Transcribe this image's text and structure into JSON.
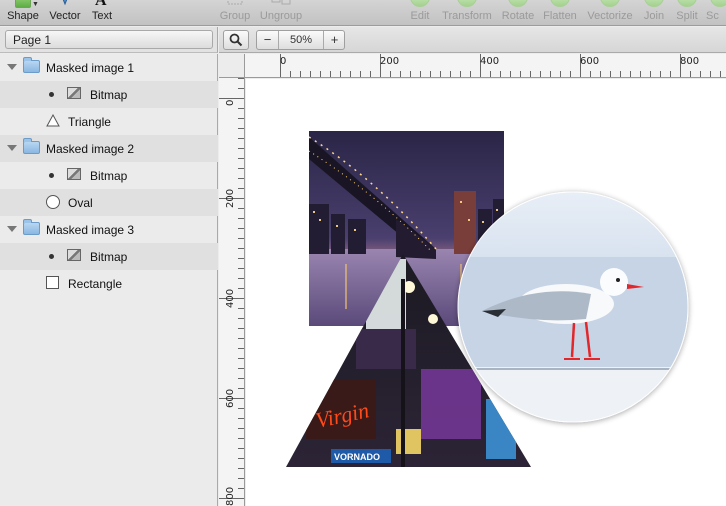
{
  "toolbar": {
    "tools": [
      {
        "label": "Shape",
        "icon": "shape-icon",
        "enabled": true
      },
      {
        "label": "Vector",
        "icon": "vector-pen-icon",
        "enabled": true
      },
      {
        "label": "Text",
        "icon": "text-icon",
        "enabled": true
      },
      {
        "label": "Group",
        "icon": "group-icon",
        "enabled": false
      },
      {
        "label": "Ungroup",
        "icon": "ungroup-icon",
        "enabled": false
      },
      {
        "label": "Edit",
        "icon": "edit-icon",
        "enabled": false
      },
      {
        "label": "Transform",
        "icon": "transform-icon",
        "enabled": false
      },
      {
        "label": "Rotate",
        "icon": "rotate-icon",
        "enabled": false
      },
      {
        "label": "Flatten",
        "icon": "flatten-icon",
        "enabled": false
      },
      {
        "label": "Vectorize",
        "icon": "vectorize-icon",
        "enabled": false
      },
      {
        "label": "Join",
        "icon": "join-icon",
        "enabled": false
      },
      {
        "label": "Split",
        "icon": "split-icon",
        "enabled": false
      },
      {
        "label": "Sc",
        "icon": "scissors-icon",
        "enabled": false
      }
    ]
  },
  "pages": {
    "current": "Page 1"
  },
  "canvas_bar": {
    "zoom": "50%",
    "zoom_out": "−",
    "zoom_in": "+"
  },
  "layers": [
    {
      "label": "Masked image 1",
      "type": "group"
    },
    {
      "label": "Bitmap",
      "type": "bitmap"
    },
    {
      "label": "Triangle",
      "type": "triangle"
    },
    {
      "label": "Masked image 2",
      "type": "group"
    },
    {
      "label": "Bitmap",
      "type": "bitmap"
    },
    {
      "label": "Oval",
      "type": "oval"
    },
    {
      "label": "Masked image 3",
      "type": "group"
    },
    {
      "label": "Bitmap",
      "type": "bitmap"
    },
    {
      "label": "Rectangle",
      "type": "rectangle"
    }
  ],
  "rulers": {
    "horizontal": [
      "0",
      "200",
      "400",
      "600",
      "800"
    ],
    "vertical": [
      "0",
      "200",
      "400",
      "600",
      "800"
    ]
  },
  "artwork": {
    "neon_sign": "Virgin",
    "storefront_sign": "VORNADO"
  },
  "colors": {
    "folder": "#8ab7e2",
    "toolbar_green": "#5fae45",
    "neon_red": "#ff4a1a",
    "night_sky": "#2a2647"
  }
}
